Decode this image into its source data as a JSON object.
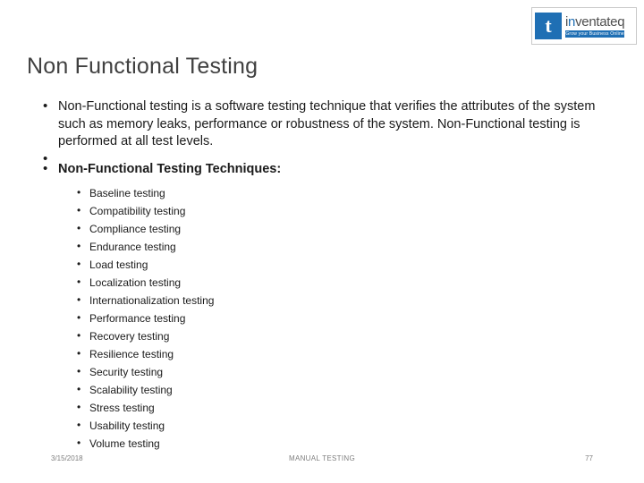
{
  "logo": {
    "mark_letter": "t",
    "name_prefix": "i",
    "name_highlight": "n",
    "name_suffix": "ventateq",
    "tagline": "Grow your Business Online"
  },
  "slide": {
    "title": "Non Functional Testing",
    "bullets": [
      {
        "text": "Non-Functional testing is a software testing technique that verifies the attributes of the system such as memory leaks, performance or robustness of the system. Non-Functional testing is performed at all test levels.",
        "bold": false
      },
      {
        "text": "Non-Functional Testing Techniques:",
        "bold": true
      }
    ],
    "techniques": [
      "Baseline testing",
      "Compatibility testing",
      "Compliance testing",
      "Endurance testing",
      "Load testing",
      "Localization testing",
      "Internationalization testing",
      "Performance testing",
      "Recovery testing",
      "Resilience testing",
      "Security testing",
      "Scalability testing",
      "Stress testing",
      "Usability testing",
      "Volume testing"
    ]
  },
  "footer": {
    "date": "3/15/2018",
    "center": "MANUAL TESTING",
    "page": "77"
  }
}
